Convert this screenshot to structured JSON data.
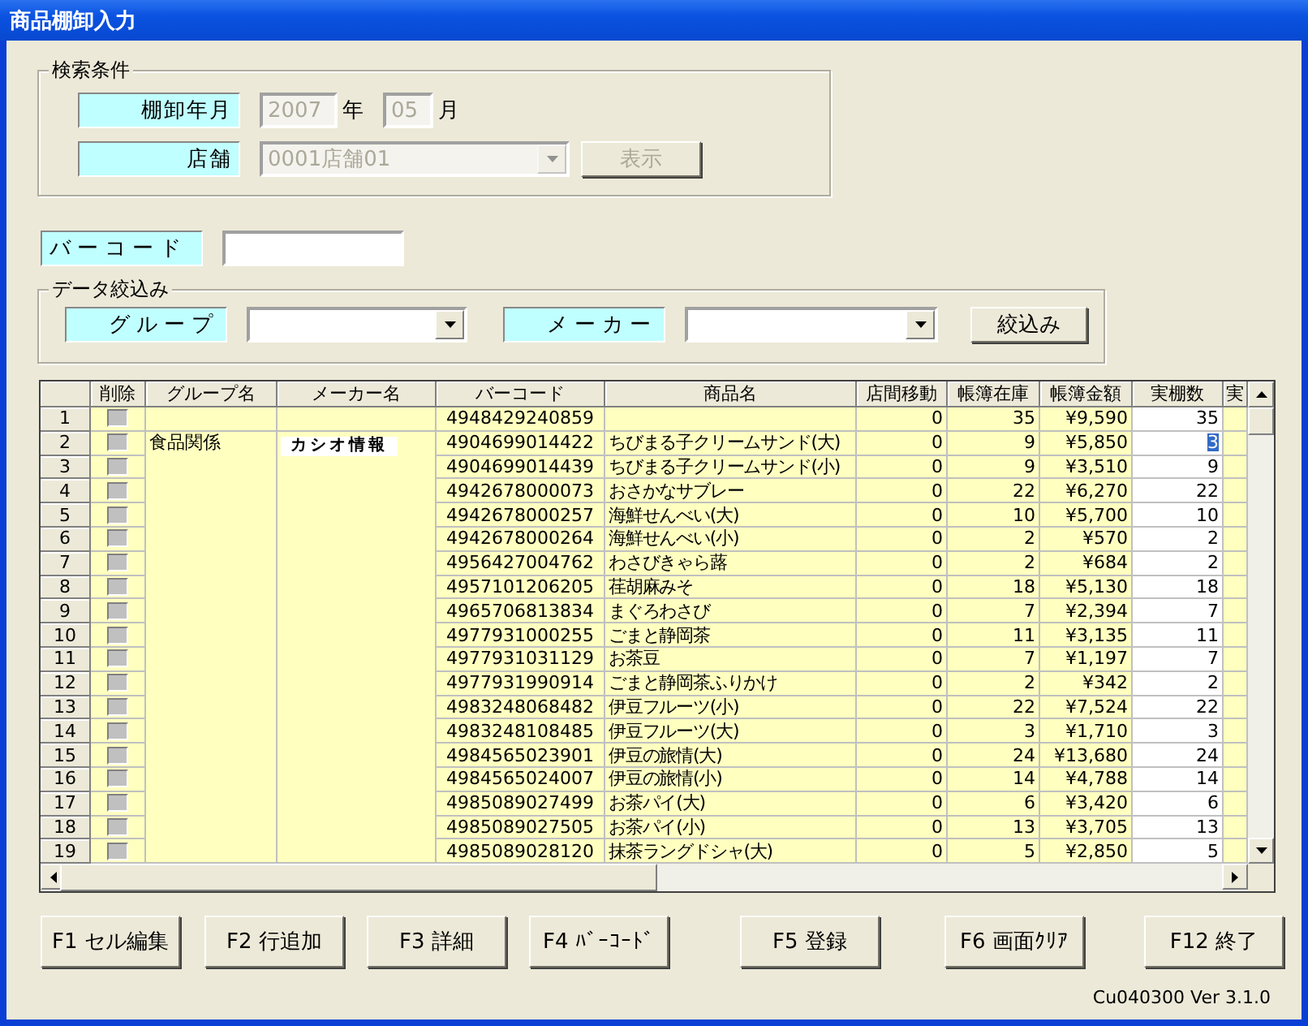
{
  "window": {
    "title": "商品棚卸入力"
  },
  "search_conditions": {
    "title": "検索条件",
    "disabled": true,
    "period_label": "棚卸年月",
    "year": "2007",
    "year_unit": "年",
    "month": "05",
    "month_unit": "月",
    "store_label": "店舗",
    "store": "0001店舗01",
    "show_button": "表示"
  },
  "barcode": {
    "label": "バーコード"
  },
  "filter": {
    "title": "データ絞込み",
    "group_label": "グループ",
    "maker_label": "メーカー",
    "button": "絞込み"
  },
  "table": {
    "columns": [
      "削除",
      "グループ名",
      "メーカー名",
      "バーコード",
      "商品名",
      "店間移動",
      "帳簿在庫",
      "帳簿金額",
      "実棚数",
      "実"
    ],
    "rows": [
      {
        "no": "1",
        "checked": false,
        "barcode": "4948429240859",
        "transfer": "0",
        "stock": "35",
        "amount": "¥9,590",
        "count": "35",
        "selected": false
      },
      {
        "no": "2",
        "checked": false,
        "group": "食品関係",
        "maker": "カシオ情報",
        "barcode": "4904699014422",
        "name": "ちびまる子クリームサンド(大)",
        "transfer": "0",
        "stock": "9",
        "amount": "¥5,850",
        "count": "3",
        "selected": true
      },
      {
        "no": "3",
        "checked": false,
        "barcode": "4904699014439",
        "name": "ちびまる子クリームサンド(小)",
        "transfer": "0",
        "stock": "9",
        "amount": "¥3,510",
        "count": "9",
        "selected": false
      },
      {
        "no": "4",
        "checked": false,
        "barcode": "4942678000073",
        "name": "おさかなサブレー",
        "transfer": "0",
        "stock": "22",
        "amount": "¥6,270",
        "count": "22",
        "selected": false
      },
      {
        "no": "5",
        "checked": false,
        "barcode": "4942678000257",
        "name": "海鮮せんべい(大)",
        "transfer": "0",
        "stock": "10",
        "amount": "¥5,700",
        "count": "10",
        "selected": false
      },
      {
        "no": "6",
        "checked": false,
        "barcode": "4942678000264",
        "name": "海鮮せんべい(小)",
        "transfer": "0",
        "stock": "2",
        "amount": "¥570",
        "count": "2",
        "selected": false
      },
      {
        "no": "7",
        "checked": false,
        "barcode": "4956427004762",
        "name": "わさびきゃら蕗",
        "transfer": "0",
        "stock": "2",
        "amount": "¥684",
        "count": "2",
        "selected": false
      },
      {
        "no": "8",
        "checked": false,
        "barcode": "4957101206205",
        "name": "荏胡麻みそ",
        "transfer": "0",
        "stock": "18",
        "amount": "¥5,130",
        "count": "18",
        "selected": false
      },
      {
        "no": "9",
        "checked": false,
        "barcode": "4965706813834",
        "name": "まぐろわさび",
        "transfer": "0",
        "stock": "7",
        "amount": "¥2,394",
        "count": "7",
        "selected": false
      },
      {
        "no": "10",
        "checked": false,
        "barcode": "4977931000255",
        "name": "ごまと静岡茶",
        "transfer": "0",
        "stock": "11",
        "amount": "¥3,135",
        "count": "11",
        "selected": false
      },
      {
        "no": "11",
        "checked": false,
        "barcode": "4977931031129",
        "name": "お茶豆",
        "transfer": "0",
        "stock": "7",
        "amount": "¥1,197",
        "count": "7",
        "selected": false
      },
      {
        "no": "12",
        "checked": false,
        "barcode": "4977931990914",
        "name": "ごまと静岡茶ふりかけ",
        "transfer": "0",
        "stock": "2",
        "amount": "¥342",
        "count": "2",
        "selected": false
      },
      {
        "no": "13",
        "checked": false,
        "barcode": "4983248068482",
        "name": "伊豆フルーツ(小)",
        "transfer": "0",
        "stock": "22",
        "amount": "¥7,524",
        "count": "22",
        "selected": false
      },
      {
        "no": "14",
        "checked": false,
        "barcode": "4983248108485",
        "name": "伊豆フルーツ(大)",
        "transfer": "0",
        "stock": "3",
        "amount": "¥1,710",
        "count": "3",
        "selected": false
      },
      {
        "no": "15",
        "checked": false,
        "barcode": "4984565023901",
        "name": "伊豆の旅情(大)",
        "transfer": "0",
        "stock": "24",
        "amount": "¥13,680",
        "count": "24",
        "selected": false
      },
      {
        "no": "16",
        "checked": false,
        "barcode": "4984565024007",
        "name": "伊豆の旅情(小)",
        "transfer": "0",
        "stock": "14",
        "amount": "¥4,788",
        "count": "14",
        "selected": false
      },
      {
        "no": "17",
        "checked": false,
        "barcode": "4985089027499",
        "name": "お茶パイ(大)",
        "transfer": "0",
        "stock": "6",
        "amount": "¥3,420",
        "count": "6",
        "selected": false
      },
      {
        "no": "18",
        "checked": false,
        "barcode": "4985089027505",
        "name": "お茶パイ(小)",
        "transfer": "0",
        "stock": "13",
        "amount": "¥3,705",
        "count": "13",
        "selected": false
      },
      {
        "no": "19",
        "checked": false,
        "barcode": "4985089028120",
        "name": "抹茶ラングドシャ(大)",
        "transfer": "0",
        "stock": "5",
        "amount": "¥2,850",
        "count": "5",
        "selected": false
      }
    ]
  },
  "buttons": [
    "F1 セル編集",
    "F2 行追加",
    "F3 詳細",
    "F4 ﾊﾞｰｺｰﾄﾞ",
    "F5 登録",
    "F6 画面ｸﾘｱ",
    "F12 終了"
  ],
  "version": "Cu040300 Ver 3.1.0"
}
